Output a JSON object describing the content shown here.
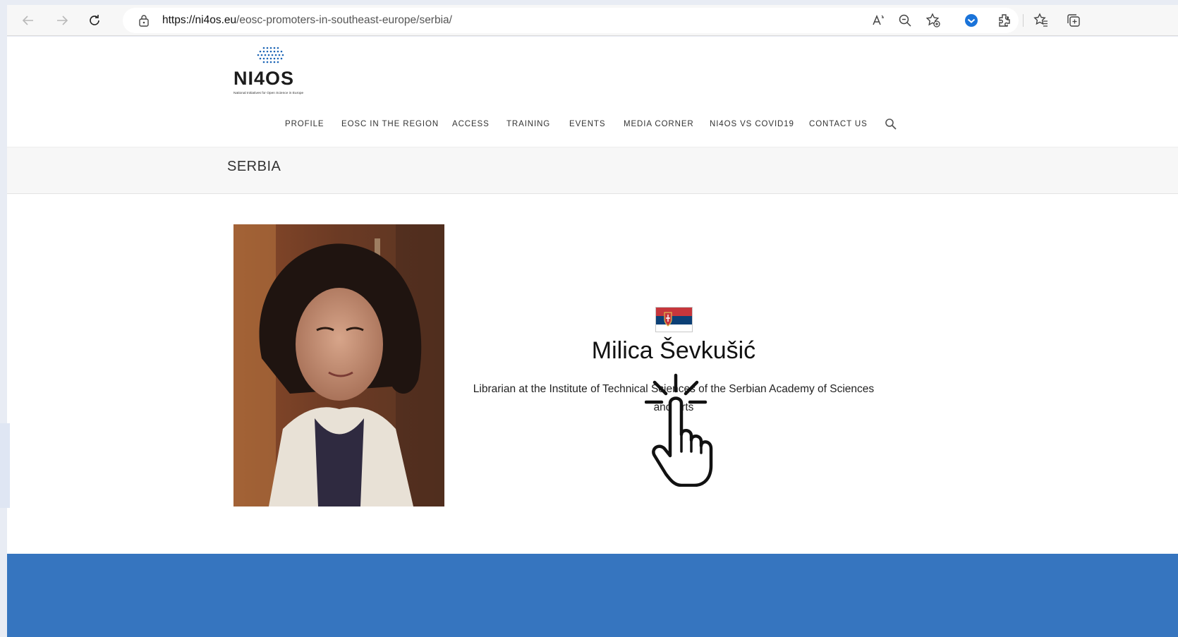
{
  "browser": {
    "url_host": "https://ni4os.eu",
    "url_path": "/eosc-promoters-in-southeast-europe/serbia/",
    "icons": [
      "back-icon",
      "forward-icon",
      "refresh-icon",
      "lock-icon",
      "read-aloud-icon",
      "zoom-out-icon",
      "add-favorite-icon",
      "shield-extension-icon",
      "extensions-icon",
      "favorites-icon",
      "collections-icon"
    ]
  },
  "site": {
    "logo_text": "NI4OS",
    "logo_tagline": "National Initiatives for Open Science in Europe",
    "menu": [
      "PROFILE",
      "EOSC IN THE REGION",
      "ACCESS",
      "TRAINING",
      "EVENTS",
      "MEDIA CORNER",
      "NI4OS VS COVID19",
      "CONTACT US"
    ],
    "page_title": "SERBIA"
  },
  "profile": {
    "name": "Milica Ševkušić",
    "role": "Librarian at the Institute of Technical Sciences of the Serbian Academy of Sciences and Arts",
    "flag": "serbia-flag",
    "photo": "portrait-photo"
  },
  "colors": {
    "footer": "#3675bf",
    "flag_red": "#c6363c",
    "flag_blue": "#0c4076",
    "flag_white": "#ffffff",
    "logo_blue": "#1e66b6"
  }
}
